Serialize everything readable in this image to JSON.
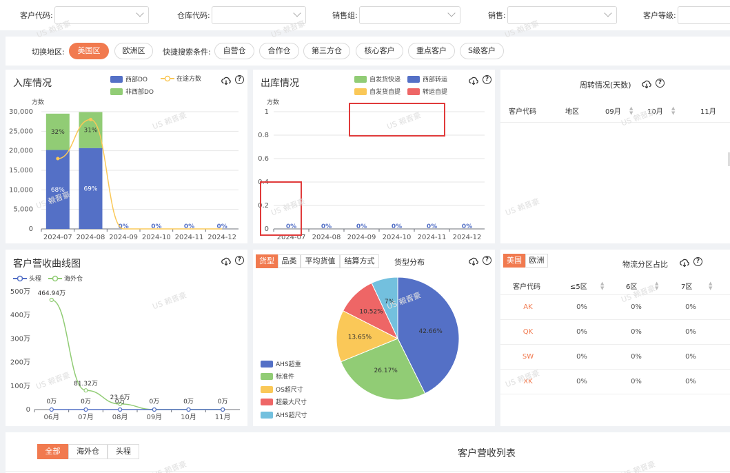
{
  "filters": [
    {
      "label": "客户代码:"
    },
    {
      "label": "仓库代码:"
    },
    {
      "label": "销售组:"
    },
    {
      "label": "销售:"
    },
    {
      "label": "客户等级:"
    }
  ],
  "region": {
    "label": "切换地区:",
    "regions": [
      "美国区",
      "欧洲区"
    ],
    "quick_label": "快捷搜索条件:",
    "quick": [
      "自营仓",
      "合作仓",
      "第三方仓",
      "核心客户",
      "重点客户",
      "S级客户"
    ]
  },
  "watermark": "US 赖晋豪",
  "inbound": {
    "title": "入库情况",
    "unit": "方数",
    "legend": [
      "西部DO",
      "在途方数",
      "非西部DO"
    ],
    "colors": {
      "west": "#5470c6",
      "nonwest": "#91cc75",
      "transit": "#fac858"
    },
    "bar_labels": [
      "68%",
      "32%",
      "69%",
      "31%"
    ],
    "zero_labels": [
      "0%",
      "0%",
      "0%",
      "0%"
    ]
  },
  "outbound": {
    "title": "出库情况",
    "unit": "方数",
    "legend": [
      "自发货快递",
      "西部转运",
      "自发货自提",
      "转运自提"
    ],
    "colors": {
      "c1": "#91cc75",
      "c2": "#5470c6",
      "c3": "#fac858",
      "c4": "#ee6666"
    },
    "zero_labels": [
      "0%",
      "0%",
      "0%",
      "0%",
      "0%",
      "0%"
    ]
  },
  "turnover": {
    "title": "周转情况(天数)",
    "columns": [
      "客户代码",
      "地区",
      "09月",
      "10月",
      "11月"
    ]
  },
  "revenue": {
    "title": "客户营收曲线图",
    "legend": [
      "头程",
      "海外仓"
    ],
    "colors": {
      "head": "#5470c6",
      "overseas": "#91cc75"
    },
    "point_labels": [
      "464.94万",
      "81.32万",
      "23.6万"
    ],
    "zero_labels": [
      "0万",
      "0万",
      "0万",
      "0万",
      "0万",
      "0万"
    ]
  },
  "goods": {
    "tabs": [
      "货型",
      "品类",
      "平均货值",
      "结算方式"
    ],
    "title": "货型分布",
    "legend": [
      "AHS超重",
      "标准件",
      "OS超尺寸",
      "超最大尺寸",
      "AHS超尺寸"
    ],
    "colors": [
      "#5470c6",
      "#91cc75",
      "#fac858",
      "#ee6666",
      "#73c0de"
    ]
  },
  "zones": {
    "tabs": [
      "美国",
      "欧洲"
    ],
    "title": "物流分区占比",
    "columns": [
      "客户代码",
      "≤5区",
      "6区",
      "7区"
    ],
    "rows": [
      {
        "code": "AK",
        "v1": "0%",
        "v2": "0%",
        "v3": "0%"
      },
      {
        "code": "QK",
        "v1": "0%",
        "v2": "0%",
        "v3": "0%"
      },
      {
        "code": "SW",
        "v1": "0%",
        "v2": "0%",
        "v3": "0%"
      },
      {
        "code": "XK",
        "v1": "0%",
        "v2": "0%",
        "v3": "0%"
      }
    ]
  },
  "list": {
    "tabs": [
      "全部",
      "海外仓",
      "头程"
    ],
    "title": "客户营收列表"
  },
  "chart_data": [
    {
      "type": "bar",
      "title": "入库情况",
      "ylabel": "方数",
      "categories": [
        "2024-07",
        "2024-08",
        "2024-09",
        "2024-10",
        "2024-11",
        "2024-12"
      ],
      "yticks": [
        "0",
        "5,000",
        "10,000",
        "15,000",
        "20,000",
        "25,000",
        "30,000"
      ],
      "ylim": [
        0,
        30000
      ],
      "series": [
        {
          "name": "西部DO",
          "values": [
            20200,
            20700,
            0,
            0,
            0,
            0
          ]
        },
        {
          "name": "非西部DO",
          "values": [
            9300,
            9200,
            0,
            0,
            0,
            0
          ]
        },
        {
          "name": "在途方数",
          "values": [
            18000,
            28000,
            0,
            0,
            0,
            0
          ]
        }
      ]
    },
    {
      "type": "bar",
      "title": "出库情况",
      "ylabel": "方数",
      "categories": [
        "2024-07",
        "2024-08",
        "2024-09",
        "2024-10",
        "2024-11",
        "2024-12"
      ],
      "yticks": [
        "0",
        "0.2",
        "0.4",
        "0.6",
        "0.8",
        "1"
      ],
      "ylim": [
        0,
        1
      ],
      "series": [
        {
          "name": "自发货快递",
          "values": [
            0,
            0,
            0,
            0,
            0,
            0
          ]
        },
        {
          "name": "西部转运",
          "values": [
            0,
            0,
            0,
            0,
            0,
            0
          ]
        },
        {
          "name": "自发货自提",
          "values": [
            0,
            0,
            0,
            0,
            0,
            0
          ]
        },
        {
          "name": "转运自提",
          "values": [
            0,
            0,
            0,
            0,
            0,
            0
          ]
        }
      ]
    },
    {
      "type": "line",
      "title": "客户营收曲线图",
      "categories": [
        "06月",
        "07月",
        "08月",
        "09月",
        "10月",
        "11月"
      ],
      "yticks": [
        "0",
        "100万",
        "200万",
        "300万",
        "400万",
        "500万"
      ],
      "ylim": [
        0,
        500
      ],
      "series": [
        {
          "name": "头程",
          "values": [
            0,
            0,
            0,
            0,
            0,
            0
          ]
        },
        {
          "name": "海外仓",
          "values": [
            464.94,
            81.32,
            23.6,
            0,
            0,
            0
          ]
        }
      ]
    },
    {
      "type": "pie",
      "title": "货型分布",
      "labels": [
        "AHS超重",
        "标准件",
        "OS超尺寸",
        "超最大尺寸",
        "AHS超尺寸"
      ],
      "values": [
        42.66,
        26.17,
        13.65,
        10.52,
        7.0
      ],
      "value_labels": [
        "42.66%",
        "26.17%",
        "13.65%",
        "10.52%",
        "7%"
      ]
    }
  ]
}
